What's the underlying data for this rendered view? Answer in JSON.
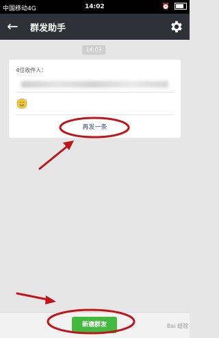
{
  "statusbar": {
    "carrier": "中国移动4G",
    "time": "14:02"
  },
  "header": {
    "back_icon": "back-arrow-icon",
    "title": "群发助手",
    "settings_icon": "gear-icon"
  },
  "message": {
    "time": "14:02",
    "recipients_label": "4位收件人：",
    "emoji": "smiley-emoji",
    "resend_label": "再发一条"
  },
  "footer": {
    "new_broadcast_label": "新建群发"
  },
  "watermark": "Bai 经验",
  "colors": {
    "titlebar": "#2f3138",
    "button_green": "#43b940",
    "annotation_red": "#c1131a"
  }
}
